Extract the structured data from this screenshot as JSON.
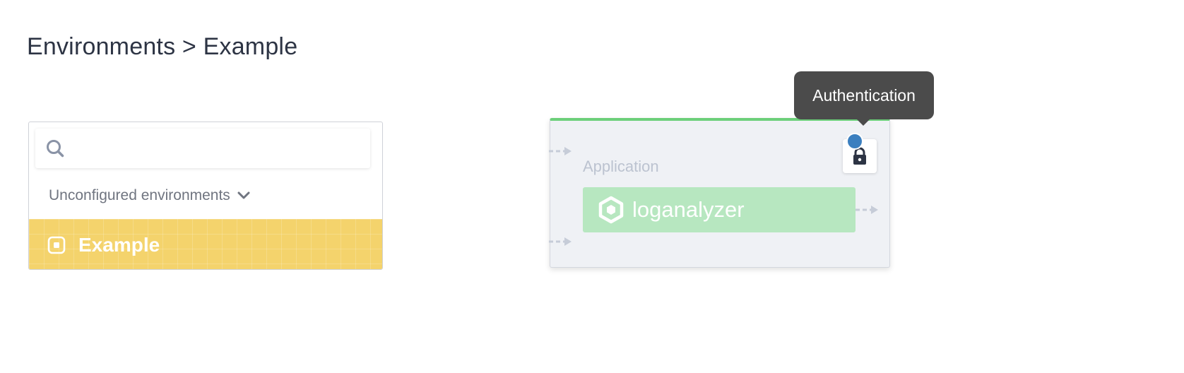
{
  "breadcrumb": {
    "text": "Environments > Example"
  },
  "env_panel": {
    "search": {
      "placeholder": "",
      "value": ""
    },
    "group_label": "Unconfigured environments",
    "items": [
      {
        "label": "Example",
        "color": "#f4d36c"
      }
    ]
  },
  "node": {
    "type_label": "Application",
    "app_name": "loganalyzer",
    "status_color": "#6ccf7a",
    "app_bar_color": "#b7e7c0",
    "badge_color": "#3b7fbf"
  },
  "tooltip": {
    "text": "Authentication"
  },
  "icons": {
    "search": "search-icon",
    "chevron": "chevron-down-icon",
    "environment": "environment-square-icon",
    "application": "hexagon-icon",
    "lock": "lock-icon",
    "arrow": "dashed-arrow-icon"
  }
}
